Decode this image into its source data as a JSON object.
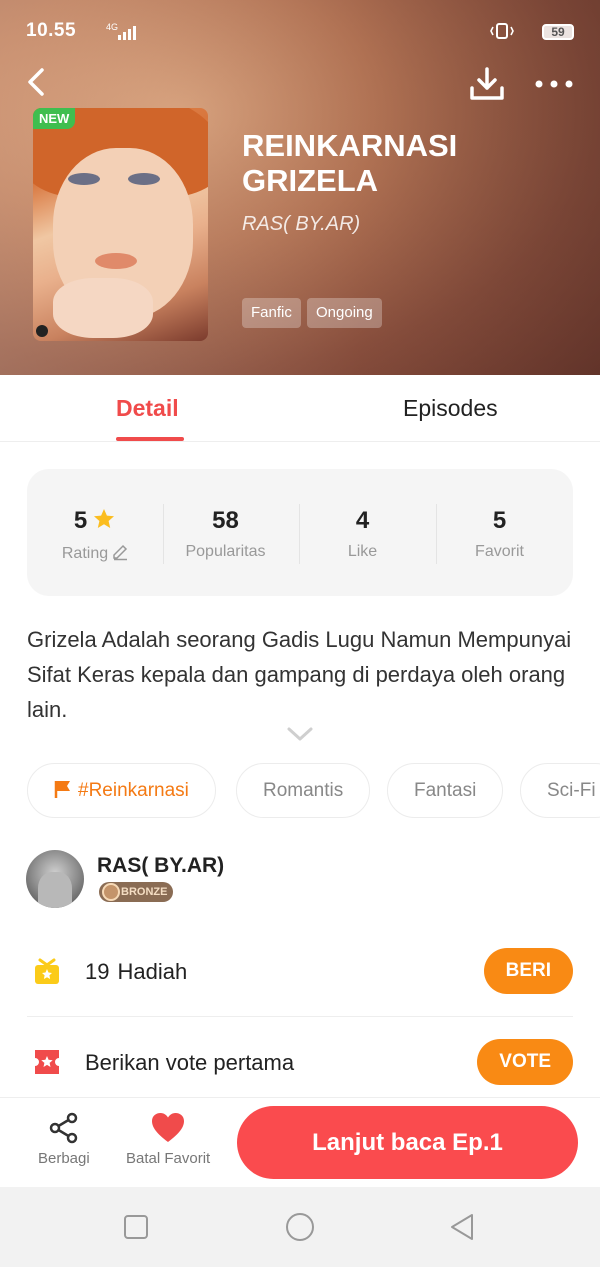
{
  "status_bar": {
    "time": "10.55",
    "network": "4G",
    "battery": "59"
  },
  "book": {
    "new_badge": "NEW",
    "title": "REINKARNASI GRIZELA",
    "author": "RAS( BY.AR)",
    "tags": [
      "Fanfic",
      "Ongoing"
    ]
  },
  "tabs": {
    "detail": "Detail",
    "episodes": "Episodes"
  },
  "stats": [
    {
      "value": "5",
      "label": "Rating"
    },
    {
      "value": "58",
      "label": "Popularitas"
    },
    {
      "value": "4",
      "label": "Like"
    },
    {
      "value": "5",
      "label": "Favorit"
    }
  ],
  "synopsis": "Grizela Adalah  seorang Gadis Lugu Namun Mempunyai Sifat Keras kepala dan gampang di perdaya oleh orang lain.",
  "genres": [
    "#Reinkarnasi",
    "Romantis",
    "Fantasi",
    "Sci-Fi"
  ],
  "author_card": {
    "name": "RAS( BY.AR)",
    "rank": "BRONZE"
  },
  "gift": {
    "count": "19",
    "label": "Hadiah",
    "button": "BERI"
  },
  "vote": {
    "label": "Berikan vote pertama",
    "button": "VOTE"
  },
  "bottom": {
    "share": "Berbagi",
    "favorite": "Batal Favorit",
    "cta": "Lanjut baca Ep.1"
  },
  "colors": {
    "accent": "#f04b4b",
    "cta": "#fa4b4e",
    "orange": "#f98a14",
    "new_badge": "#3fbe4f"
  },
  "icons": [
    "back-arrow-icon",
    "download-icon",
    "more-icon",
    "star-icon",
    "pencil-icon",
    "chevron-down-icon",
    "flag-icon",
    "gift-icon",
    "ticket-icon",
    "share-icon",
    "heart-icon",
    "nav-recent-icon",
    "nav-home-icon",
    "nav-back-icon"
  ]
}
